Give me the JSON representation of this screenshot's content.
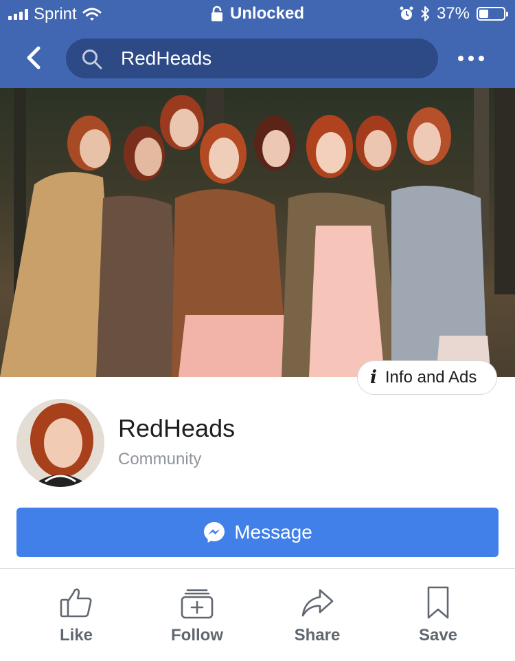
{
  "status_bar": {
    "carrier": "Sprint",
    "lock_text": "Unlocked",
    "battery": "37%",
    "battery_level": 0.37
  },
  "nav": {
    "search_text": "RedHeads"
  },
  "cover": {
    "info_ads_label": "Info and Ads"
  },
  "profile": {
    "name": "RedHeads",
    "category": "Community"
  },
  "message_button": {
    "label": "Message"
  },
  "actions": [
    {
      "label": "Like",
      "icon": "thumbs-up-icon"
    },
    {
      "label": "Follow",
      "icon": "follow-box-icon"
    },
    {
      "label": "Share",
      "icon": "share-arrow-icon"
    },
    {
      "label": "Save",
      "icon": "bookmark-icon"
    }
  ],
  "colors": {
    "brand": "#4267b2",
    "search_bg": "#2d4a87",
    "message_button": "#4080e8",
    "action_text": "#606770"
  }
}
